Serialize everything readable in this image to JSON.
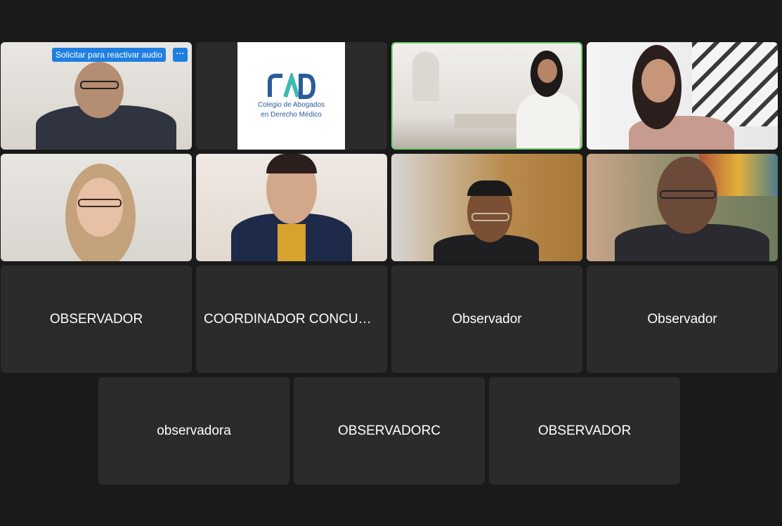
{
  "colors": {
    "background": "#1a1a1a",
    "tile": "#2b2b2b",
    "active_speaker_border": "#6fd36f",
    "accent_blue": "#1f7fe0",
    "logo_blue": "#2a5c9a",
    "logo_teal": "#3fb8b0"
  },
  "video_tiles": {
    "tile1": {
      "unmute_request_label": "Solicitar para reactivar audio",
      "more_icon": "more-dots-icon",
      "more_glyph": "···"
    },
    "tile2": {
      "logo_line1": "Colegio de Abogados",
      "logo_line2": "en Derecho Médico"
    }
  },
  "name_tiles": [
    {
      "name": "OBSERVADOR"
    },
    {
      "name": "COORDINADOR CONCURSO"
    },
    {
      "name": "Observador"
    },
    {
      "name": "Observador"
    },
    {
      "name": "observadora"
    },
    {
      "name": "OBSERVADORC"
    },
    {
      "name": "OBSERVADOR"
    }
  ]
}
